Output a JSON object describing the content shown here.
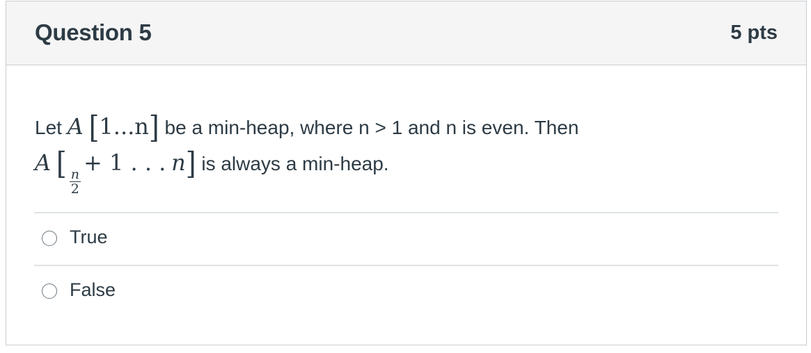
{
  "question": {
    "title": "Question 5",
    "points": "5 pts"
  },
  "body": {
    "line1_prefix": "Let ",
    "line1_var": "A",
    "line1_range": "1...n",
    "line1_suffix": " be a min-heap, where n > 1 and n is even. Then",
    "line2_var": "A",
    "line2_frac_num": "n",
    "line2_frac_den": "2",
    "line2_plus_one": "+ 1 . . .",
    "line2_end": "n",
    "line2_suffix": " is always a min-heap."
  },
  "answers": [
    {
      "label": "True",
      "selected": false
    },
    {
      "label": "False",
      "selected": false
    }
  ]
}
